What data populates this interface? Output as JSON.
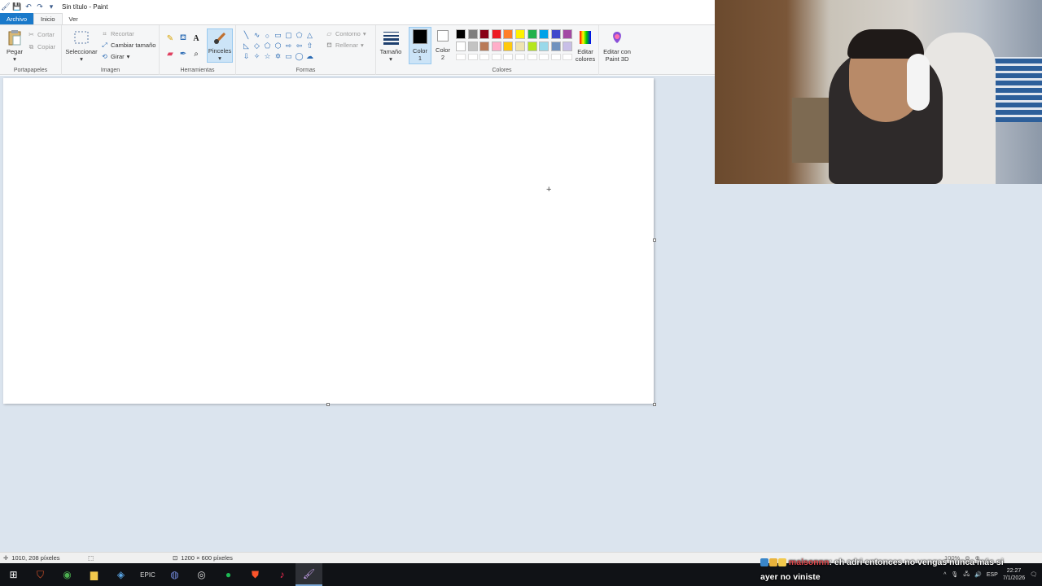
{
  "window": {
    "title": "Sin título - Paint"
  },
  "quick_access": [
    "save-icon",
    "undo-icon",
    "redo-icon",
    "customize-icon"
  ],
  "tabs": [
    {
      "label": "Archivo"
    },
    {
      "label": "Inicio"
    },
    {
      "label": "Ver"
    }
  ],
  "ribbon": {
    "clipboard": {
      "label": "Portapapeles",
      "paste": "Pegar",
      "cut": "Cortar",
      "copy": "Copiar"
    },
    "image": {
      "label": "Imagen",
      "select": "Seleccionar",
      "crop": "Recortar",
      "resize": "Cambiar tamaño",
      "rotate": "Girar"
    },
    "tools": {
      "label": "Herramientas",
      "brushes": "Pinceles"
    },
    "shapes": {
      "label": "Formas",
      "outline": "Contorno",
      "fill": "Rellenar"
    },
    "size": {
      "label": "Tamaño"
    },
    "colors": {
      "label": "Colores",
      "color1_line1": "Color",
      "color1_line2": "1",
      "color2_line1": "Color",
      "color2_line2": "2",
      "edit_line1": "Editar",
      "edit_line2": "colores",
      "paint3d_line1": "Editar con",
      "paint3d_line2": "Paint 3D",
      "color1": "#000000",
      "color2": "#ffffff",
      "palette_row1": [
        "#000000",
        "#7f7f7f",
        "#880015",
        "#ed1c24",
        "#ff7f27",
        "#fff200",
        "#22b14c",
        "#00a2e8",
        "#3f48cc",
        "#a349a4"
      ],
      "palette_row2": [
        "#ffffff",
        "#c3c3c3",
        "#b97a57",
        "#ffaec9",
        "#ffc90e",
        "#efe4b0",
        "#b5e61d",
        "#99d9ea",
        "#7092be",
        "#c8bfe7"
      ]
    }
  },
  "status": {
    "cursor_pos": "1010, 208 píxeles",
    "canvas_size": "1200 × 600 píxeles",
    "zoom": "100%"
  },
  "chat": {
    "username": "maisonnn",
    "message_line1": ": eh adri entonces no vengas nunca más si",
    "message_line2": "ayer no viniste"
  },
  "taskbar": {
    "apps": [
      "windows-icon",
      "antivirus-icon",
      "chrome-icon",
      "file-explorer-icon",
      "steam-icon",
      "epic-games-icon",
      "discord-icon",
      "obs-icon",
      "spotify-icon",
      "brave-icon",
      "tiktok-icon",
      "paint-icon"
    ],
    "lang": "ESP",
    "time": "22:27",
    "date": "7/1/2026"
  }
}
